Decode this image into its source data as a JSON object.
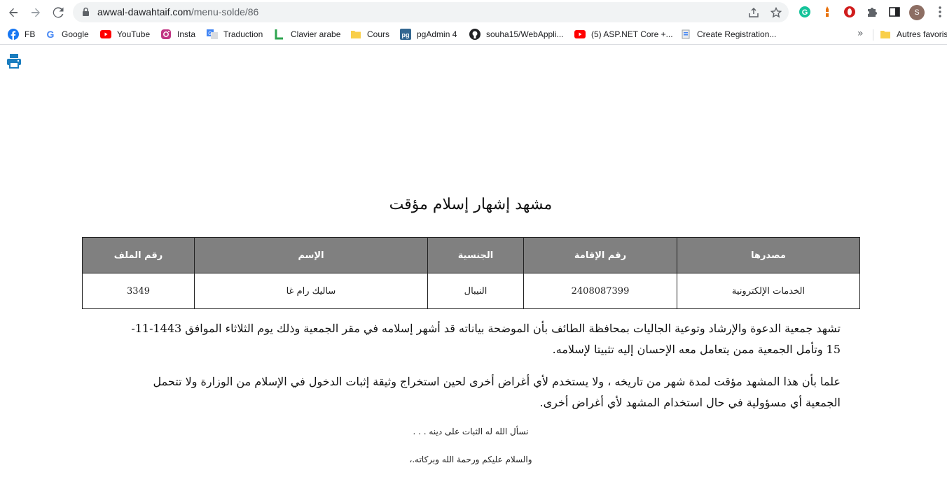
{
  "browser": {
    "url_domain": "awwal-dawahtaif.com",
    "url_path": "/menu-solde/86",
    "profile_initial": "S"
  },
  "bookmarks": [
    {
      "label": "FB",
      "icon": "facebook-icon"
    },
    {
      "label": "Google",
      "icon": "google-icon"
    },
    {
      "label": "YouTube",
      "icon": "youtube-icon"
    },
    {
      "label": "Insta",
      "icon": "instagram-icon"
    },
    {
      "label": "Traduction",
      "icon": "translate-icon"
    },
    {
      "label": "Clavier arabe",
      "icon": "keyboard-l-icon"
    },
    {
      "label": "Cours",
      "icon": "folder-icon"
    },
    {
      "label": "pgAdmin 4",
      "icon": "pgadmin-icon"
    },
    {
      "label": "souha15/WebAppli...",
      "icon": "github-icon"
    },
    {
      "label": "(5) ASP.NET Core +...",
      "icon": "youtube-icon"
    },
    {
      "label": "Create Registration...",
      "icon": "site-icon"
    }
  ],
  "bookmarks_other": "Autres favoris",
  "document": {
    "title": "مشهد إشهار إسلام مؤقت",
    "table": {
      "headers": [
        "مصدرها",
        "رقم الإقامة",
        "الجنسية",
        "الإسم",
        "رقم الملف"
      ],
      "row": [
        "الخدمات الإلكترونية",
        "2408087399",
        "النيبال",
        "ساليك رام غا",
        "3349"
      ]
    },
    "paragraph1": "تشهد جمعية الدعوة والإرشاد وتوعية الجاليات بمحافظة الطائف بأن الموضحة بياناته قد أشهر إسلامه في مقر الجمعية وذلك يوم الثلاثاء الموافق 1443-11-15 وتأمل الجمعية ممن يتعامل معه الإحسان إليه تثبيتا لإسلامه.",
    "paragraph2": "علما بأن هذا المشهد مؤقت لمدة شهر من تاريخه ، ولا يستخدم لأي أغراض أخرى لحين استخراج وثيقة إثبات الدخول في الإسلام من الوزارة ولا تتحمل الجمعية أي مسؤولية في حال استخدام المشهد لأي أغراض أخرى.",
    "note1": "نسأل الله له الثبات على دينه . . .",
    "note2": "والسلام عليكم ورحمة الله وبركاته.،"
  }
}
